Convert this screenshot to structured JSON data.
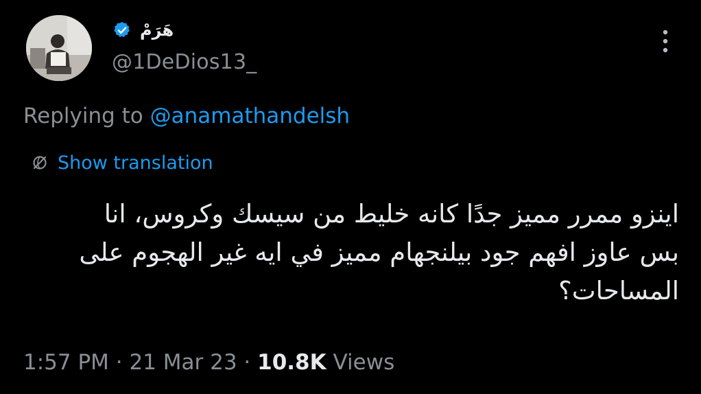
{
  "author": {
    "display_name": "هَرَمْ",
    "handle": "@1DeDios13_",
    "verified_icon": "verified-badge-icon"
  },
  "reply": {
    "prefix": "Replying to ",
    "mention": "@anamathandelsh"
  },
  "translation": {
    "label": "Show translation",
    "icon": "translate-globe-icon"
  },
  "tweet": {
    "lines": [
      "اينزو ممرر مميز جدًا كانه خليط من سيسك وكروس، انا",
      "بس عاوز افهم جود بيلنجهام مميز في ايه غير الهجوم على",
      "المساحات؟"
    ]
  },
  "meta": {
    "time": "1:57 PM",
    "sep1": " · ",
    "date": "21 Mar 23",
    "sep2": " · ",
    "views_count": "10.8K",
    "views_label": " Views"
  },
  "colors": {
    "background": "#000000",
    "text": "#e7e9ea",
    "muted": "#8a8f95",
    "accent": "#1d9bf0"
  }
}
